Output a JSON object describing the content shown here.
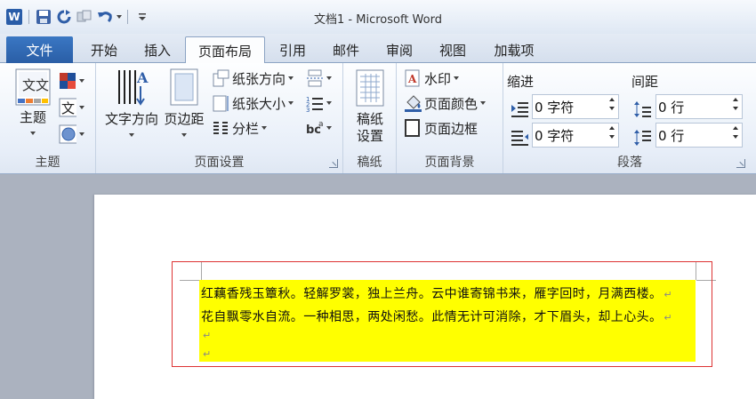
{
  "window": {
    "title": "文档1 - Microsoft Word"
  },
  "qat": {
    "icons": [
      "word-app-icon",
      "save-icon",
      "redo-icon",
      "repeat-icon",
      "undo-icon",
      "customize-qat-icon"
    ]
  },
  "tabs": {
    "file": "文件",
    "items": [
      "开始",
      "插入",
      "页面布局",
      "引用",
      "邮件",
      "审阅",
      "视图",
      "加载项"
    ],
    "active": "页面布局"
  },
  "ribbon": {
    "theme": {
      "group": "主题",
      "themes_btn": "主题"
    },
    "page_setup": {
      "group": "页面设置",
      "text_direction": "文字方向",
      "margins": "页边距",
      "orientation": "纸张方向",
      "size": "纸张大小",
      "columns": "分栏"
    },
    "draft": {
      "group": "稿纸",
      "btn_line1": "稿纸",
      "btn_line2": "设置"
    },
    "page_background": {
      "group": "页面背景",
      "watermark": "水印",
      "page_color": "页面颜色",
      "page_borders": "页面边框"
    },
    "paragraph": {
      "group": "段落",
      "indent_label": "缩进",
      "indent_left": "0 字符",
      "indent_right": "0 字符",
      "spacing_label": "间距",
      "spacing_before": "0 行",
      "spacing_after": "0 行"
    }
  },
  "document": {
    "lines": [
      "红藕香残玉簟秋。轻解罗裳，独上兰舟。云中谁寄锦书来，雁字回时，月满西楼。",
      "花自飘零水自流。一种相思，两处闲愁。此情无计可消除，才下眉头，却上心头。"
    ],
    "para_mark": "↵",
    "highlight_color": "#ffff00",
    "border_color": "#dd3333"
  },
  "colors": {
    "file_tab": "#2a5ea6",
    "ribbon_bg": "#e7eef8"
  }
}
